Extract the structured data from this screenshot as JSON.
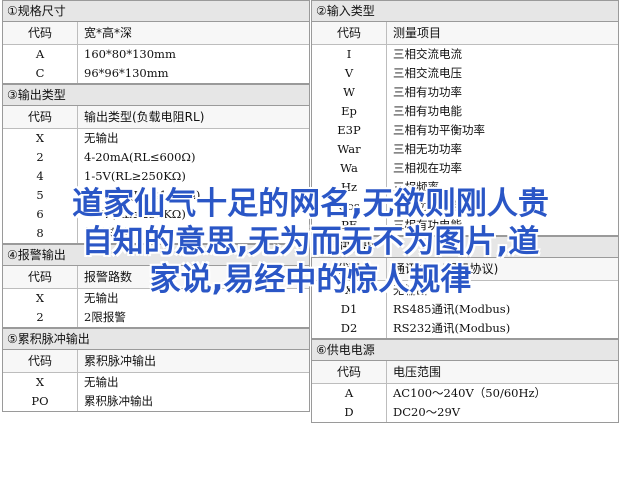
{
  "left": {
    "sections": [
      {
        "title": "①规格尺寸",
        "headers": [
          "代码",
          "宽*高*深"
        ],
        "rows": [
          [
            "A",
            "160*80*130mm"
          ],
          [
            "C",
            "96*96*130mm"
          ]
        ]
      },
      {
        "title": "③输出类型",
        "headers": [
          "代码",
          "输出类型(负载电阻RL)"
        ],
        "rows": [
          [
            "X",
            "无输出"
          ],
          [
            "2",
            "4-20mA(RL≤600Ω)"
          ],
          [
            "4",
            "1-5V(RL≥250KΩ)"
          ],
          [
            "5",
            "0-10mA(RL≤1.2KΩ)"
          ],
          [
            "6",
            "0-5V(RL≥250KΩ)"
          ],
          [
            "8",
            "特殊规格"
          ]
        ]
      },
      {
        "title": "④报警输出",
        "headers": [
          "代码",
          "报警路数"
        ],
        "rows": [
          [
            "X",
            "无输出"
          ],
          [
            "2",
            "2限报警"
          ]
        ]
      },
      {
        "title": "⑤累积脉冲输出",
        "headers": [
          "代码",
          "累积脉冲输出"
        ],
        "rows": [
          [
            "X",
            "无输出"
          ],
          [
            "PO",
            "累积脉冲输出"
          ]
        ]
      }
    ]
  },
  "right": {
    "sections": [
      {
        "title": "②输入类型",
        "headers": [
          "代码",
          "测量项目"
        ],
        "rows": [
          [
            "I",
            "三相交流电流"
          ],
          [
            "V",
            "三相交流电压"
          ],
          [
            "W",
            "三相有功功率"
          ],
          [
            "Ep",
            "三相有功电能"
          ],
          [
            "E3P",
            "三相有功平衡功率"
          ],
          [
            "War",
            "三相无功功率"
          ],
          [
            "Wa",
            "三相视在功率"
          ],
          [
            "Hz",
            "三相频率"
          ],
          [
            "Cos",
            "三相功率因数"
          ],
          [
            "PF",
            "三相有功电能"
          ]
        ]
      },
      {
        "title": "⑥通讯输出",
        "headers": [
          "代码",
          "通讯接口(通讯协议)"
        ],
        "rows": [
          [
            "X",
            "无输出"
          ],
          [
            "D1",
            "RS485通讯(Modbus)"
          ],
          [
            "D2",
            "RS232通讯(Modbus)"
          ]
        ]
      },
      {
        "title": "⑥供电电源",
        "headers": [
          "代码",
          "电压范围"
        ],
        "rows": [
          [
            "A",
            "AC100～240V（50/60Hz）"
          ],
          [
            "D",
            "DC20～29V"
          ]
        ]
      }
    ]
  },
  "overlay": {
    "lines": [
      "道家仙气十足的网名,无欲则刚人贵",
      "自知的意思,无为而无不为图片,道",
      "家说,易经中的惊人规律"
    ],
    "color": "#2a56c6"
  }
}
